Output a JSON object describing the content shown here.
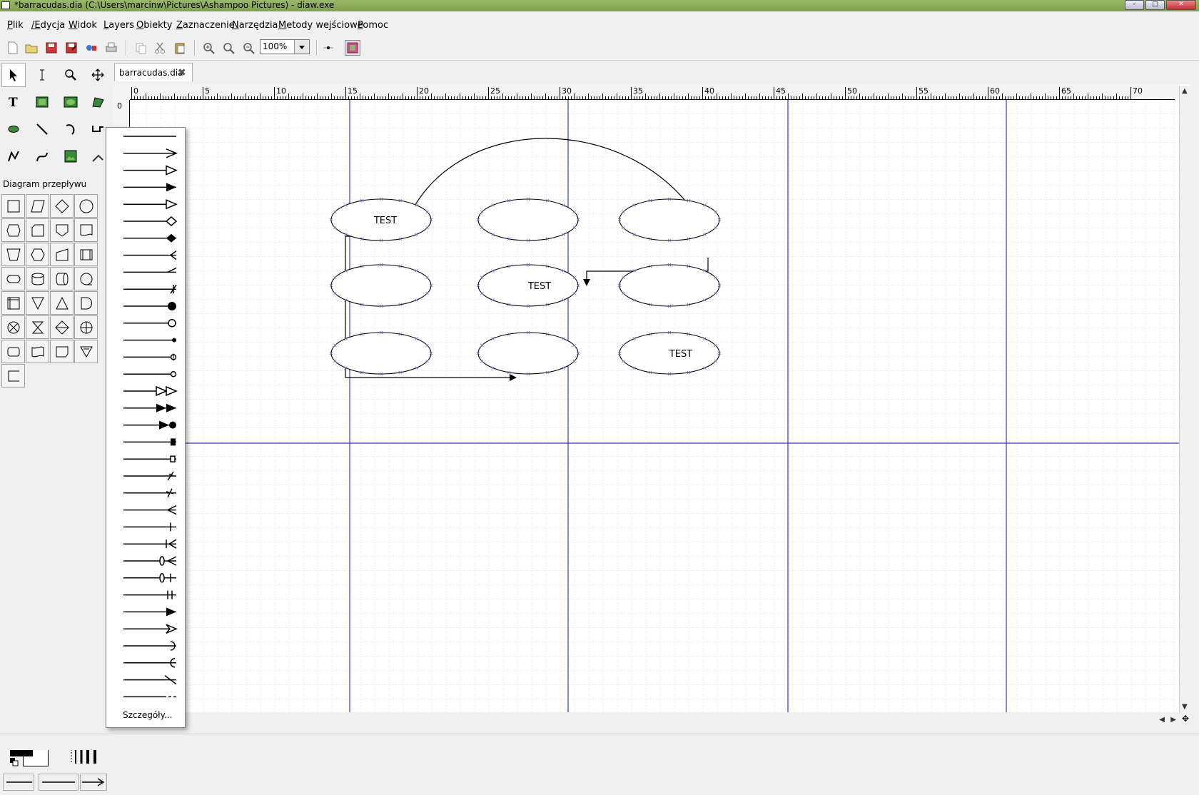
{
  "window": {
    "title": "*barracudas.dia (C:\\Users\\marcinw\\Pictures\\Ashampoo Pictures) - diaw.exe",
    "minimize": "–",
    "maximize": "□",
    "close": "✕"
  },
  "menubar": {
    "items": [
      "Plik",
      "/Edycja",
      "Widok",
      "Layers",
      "Obiekty",
      "Zaznaczenie",
      "Narzędzia",
      "Metody wejściowe",
      "Pomoc"
    ]
  },
  "toolbar": {
    "icons": [
      "new-file-icon",
      "open-folder-icon",
      "save-icon",
      "save-as-icon",
      "export-icon",
      "print-icon",
      "copy-icon",
      "cut-icon",
      "paste-icon",
      "zoom-in-icon",
      "zoom-fit-icon",
      "zoom-out-icon",
      "snap-to-grid-icon",
      "snap-to-objects-icon"
    ],
    "zoom_value": "100%"
  },
  "tools": {
    "items": [
      "pointer-icon",
      "text-edit-icon",
      "magnify-icon",
      "scroll-icon",
      "text-icon",
      "box-icon",
      "ellipse-icon",
      "polygon-icon",
      "beziergon-icon",
      "line-icon",
      "arc-icon",
      "zigzag-line-icon",
      "polyline-icon",
      "bezier-line-icon",
      "image-icon",
      "outline-icon"
    ]
  },
  "sheet": {
    "name": "Diagram przepływu"
  },
  "document": {
    "tab_name": "barracudas.dia",
    "ruler_labels": [
      "0",
      "5",
      "10",
      "15",
      "20",
      "25",
      "30",
      "35",
      "40",
      "45",
      "50",
      "55",
      "60",
      "65",
      "70"
    ],
    "vruler_label": "0",
    "nodes": [
      {
        "label": "TEST"
      },
      {
        "label": ""
      },
      {
        "label": ""
      },
      {
        "label": ""
      },
      {
        "label": "TEST"
      },
      {
        "label": ""
      },
      {
        "label": ""
      },
      {
        "label": ""
      },
      {
        "label": "TEST"
      }
    ]
  },
  "arrow_popup": {
    "details_label": "Szczegóły...",
    "styles": [
      "none",
      "lines",
      "hollow-triangle",
      "filled-triangle",
      "unfilled-triangle",
      "hollow-diamond",
      "filled-diamond",
      "crow-foot",
      "half-head",
      "slashed-cross",
      "filled-dot",
      "hollow-dot",
      "small-dot",
      "dimension-origin",
      "blanked-dot",
      "double-hollow-triangle",
      "double-filled-triangle",
      "filled-dot-n-triangle",
      "filled-box",
      "blanked-box",
      "slash-arrow",
      "integral-symbol",
      "crow-foot-alt",
      "one",
      "many",
      "zero-or-many",
      "zero-or-one",
      "one-exactly",
      "filled-concave",
      "hollow-concave",
      "rounded",
      "open-rounded",
      "backslash",
      "infinite-line"
    ]
  }
}
